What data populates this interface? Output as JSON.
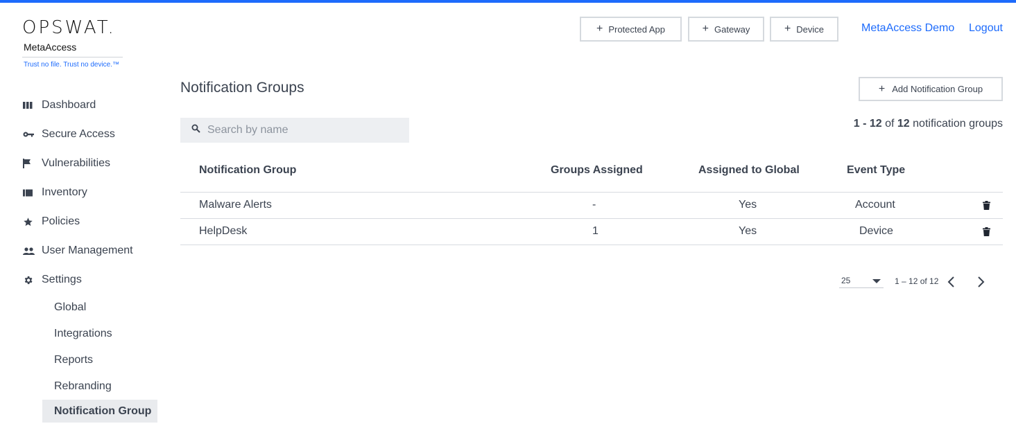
{
  "brand": {
    "logo": "OPSWAT.",
    "product": "MetaAccess",
    "tagline": "Trust no file. Trust no device.™"
  },
  "header": {
    "buttons": [
      {
        "label": "Protected App",
        "icon": "plus-icon"
      },
      {
        "label": "Gateway",
        "icon": "plus-icon"
      },
      {
        "label": "Device",
        "icon": "plus-icon"
      }
    ],
    "account_link": "MetaAccess Demo",
    "logout_link": "Logout"
  },
  "sidebar": {
    "items": [
      {
        "label": "Dashboard",
        "icon": "dashboard-icon"
      },
      {
        "label": "Secure Access",
        "icon": "key-icon"
      },
      {
        "label": "Vulnerabilities",
        "icon": "flag-icon"
      },
      {
        "label": "Inventory",
        "icon": "inventory-icon"
      },
      {
        "label": "Policies",
        "icon": "star-icon"
      },
      {
        "label": "User Management",
        "icon": "people-icon"
      },
      {
        "label": "Settings",
        "icon": "gear-icon"
      }
    ],
    "settings_children": [
      {
        "label": "Global"
      },
      {
        "label": "Integrations"
      },
      {
        "label": "Reports"
      },
      {
        "label": "Rebranding"
      },
      {
        "label": "Notification Group",
        "active": true
      }
    ]
  },
  "main": {
    "title": "Notification Groups",
    "add_button": "Add Notification Group",
    "search_placeholder": "Search by name",
    "count": {
      "range": "1 - 12",
      "of": "of",
      "total": "12",
      "suffix": "notification groups"
    },
    "columns": [
      "Notification Group",
      "Groups Assigned",
      "Assigned to Global",
      "Event Type"
    ],
    "rows": [
      {
        "name": "Malware Alerts",
        "groups_assigned": "-",
        "assigned_global": "Yes",
        "event_type": "Account"
      },
      {
        "name": "HelpDesk",
        "groups_assigned": "1",
        "assigned_global": "Yes",
        "event_type": "Device"
      }
    ],
    "pagination": {
      "page_size": "25",
      "range": "1 – 12 of 12"
    }
  },
  "colors": {
    "accent": "#1d6bfc",
    "text": "#3b4350",
    "search_bg": "#edeff2",
    "active_nav_bg": "#e9ebee"
  }
}
